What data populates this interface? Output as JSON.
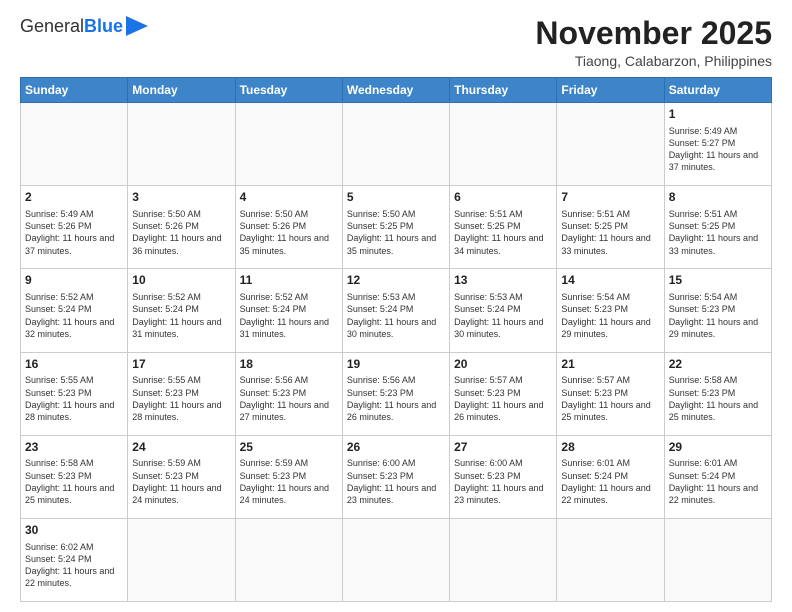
{
  "header": {
    "logo_general": "General",
    "logo_blue": "Blue",
    "month_title": "November 2025",
    "location": "Tiaong, Calabarzon, Philippines"
  },
  "weekdays": [
    "Sunday",
    "Monday",
    "Tuesday",
    "Wednesday",
    "Thursday",
    "Friday",
    "Saturday"
  ],
  "weeks": [
    [
      {
        "day": "",
        "info": ""
      },
      {
        "day": "",
        "info": ""
      },
      {
        "day": "",
        "info": ""
      },
      {
        "day": "",
        "info": ""
      },
      {
        "day": "",
        "info": ""
      },
      {
        "day": "",
        "info": ""
      },
      {
        "day": "1",
        "info": "Sunrise: 5:49 AM\nSunset: 5:27 PM\nDaylight: 11 hours and 37 minutes."
      }
    ],
    [
      {
        "day": "2",
        "info": "Sunrise: 5:49 AM\nSunset: 5:26 PM\nDaylight: 11 hours and 37 minutes."
      },
      {
        "day": "3",
        "info": "Sunrise: 5:50 AM\nSunset: 5:26 PM\nDaylight: 11 hours and 36 minutes."
      },
      {
        "day": "4",
        "info": "Sunrise: 5:50 AM\nSunset: 5:26 PM\nDaylight: 11 hours and 35 minutes."
      },
      {
        "day": "5",
        "info": "Sunrise: 5:50 AM\nSunset: 5:25 PM\nDaylight: 11 hours and 35 minutes."
      },
      {
        "day": "6",
        "info": "Sunrise: 5:51 AM\nSunset: 5:25 PM\nDaylight: 11 hours and 34 minutes."
      },
      {
        "day": "7",
        "info": "Sunrise: 5:51 AM\nSunset: 5:25 PM\nDaylight: 11 hours and 33 minutes."
      },
      {
        "day": "8",
        "info": "Sunrise: 5:51 AM\nSunset: 5:25 PM\nDaylight: 11 hours and 33 minutes."
      }
    ],
    [
      {
        "day": "9",
        "info": "Sunrise: 5:52 AM\nSunset: 5:24 PM\nDaylight: 11 hours and 32 minutes."
      },
      {
        "day": "10",
        "info": "Sunrise: 5:52 AM\nSunset: 5:24 PM\nDaylight: 11 hours and 31 minutes."
      },
      {
        "day": "11",
        "info": "Sunrise: 5:52 AM\nSunset: 5:24 PM\nDaylight: 11 hours and 31 minutes."
      },
      {
        "day": "12",
        "info": "Sunrise: 5:53 AM\nSunset: 5:24 PM\nDaylight: 11 hours and 30 minutes."
      },
      {
        "day": "13",
        "info": "Sunrise: 5:53 AM\nSunset: 5:24 PM\nDaylight: 11 hours and 30 minutes."
      },
      {
        "day": "14",
        "info": "Sunrise: 5:54 AM\nSunset: 5:23 PM\nDaylight: 11 hours and 29 minutes."
      },
      {
        "day": "15",
        "info": "Sunrise: 5:54 AM\nSunset: 5:23 PM\nDaylight: 11 hours and 29 minutes."
      }
    ],
    [
      {
        "day": "16",
        "info": "Sunrise: 5:55 AM\nSunset: 5:23 PM\nDaylight: 11 hours and 28 minutes."
      },
      {
        "day": "17",
        "info": "Sunrise: 5:55 AM\nSunset: 5:23 PM\nDaylight: 11 hours and 28 minutes."
      },
      {
        "day": "18",
        "info": "Sunrise: 5:56 AM\nSunset: 5:23 PM\nDaylight: 11 hours and 27 minutes."
      },
      {
        "day": "19",
        "info": "Sunrise: 5:56 AM\nSunset: 5:23 PM\nDaylight: 11 hours and 26 minutes."
      },
      {
        "day": "20",
        "info": "Sunrise: 5:57 AM\nSunset: 5:23 PM\nDaylight: 11 hours and 26 minutes."
      },
      {
        "day": "21",
        "info": "Sunrise: 5:57 AM\nSunset: 5:23 PM\nDaylight: 11 hours and 25 minutes."
      },
      {
        "day": "22",
        "info": "Sunrise: 5:58 AM\nSunset: 5:23 PM\nDaylight: 11 hours and 25 minutes."
      }
    ],
    [
      {
        "day": "23",
        "info": "Sunrise: 5:58 AM\nSunset: 5:23 PM\nDaylight: 11 hours and 25 minutes."
      },
      {
        "day": "24",
        "info": "Sunrise: 5:59 AM\nSunset: 5:23 PM\nDaylight: 11 hours and 24 minutes."
      },
      {
        "day": "25",
        "info": "Sunrise: 5:59 AM\nSunset: 5:23 PM\nDaylight: 11 hours and 24 minutes."
      },
      {
        "day": "26",
        "info": "Sunrise: 6:00 AM\nSunset: 5:23 PM\nDaylight: 11 hours and 23 minutes."
      },
      {
        "day": "27",
        "info": "Sunrise: 6:00 AM\nSunset: 5:23 PM\nDaylight: 11 hours and 23 minutes."
      },
      {
        "day": "28",
        "info": "Sunrise: 6:01 AM\nSunset: 5:24 PM\nDaylight: 11 hours and 22 minutes."
      },
      {
        "day": "29",
        "info": "Sunrise: 6:01 AM\nSunset: 5:24 PM\nDaylight: 11 hours and 22 minutes."
      }
    ],
    [
      {
        "day": "30",
        "info": "Sunrise: 6:02 AM\nSunset: 5:24 PM\nDaylight: 11 hours and 22 minutes."
      },
      {
        "day": "",
        "info": ""
      },
      {
        "day": "",
        "info": ""
      },
      {
        "day": "",
        "info": ""
      },
      {
        "day": "",
        "info": ""
      },
      {
        "day": "",
        "info": ""
      },
      {
        "day": "",
        "info": ""
      }
    ]
  ]
}
